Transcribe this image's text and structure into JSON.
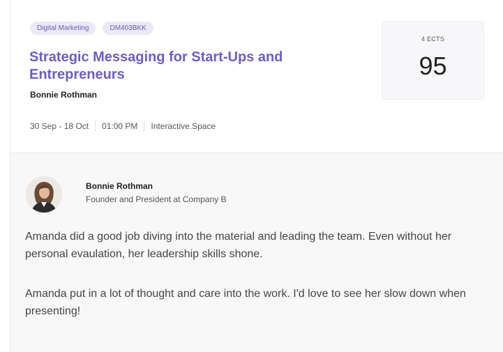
{
  "course": {
    "tags": [
      "Digital Marketing",
      "DM403BKK"
    ],
    "title": "Strategic Messaging for Start-Ups and Entrepreneurs",
    "author": "Bonnie Rothman",
    "meta": {
      "dates": "30 Sep - 18 Oct",
      "time": "01:00 PM",
      "location": "Interactive.Space"
    }
  },
  "score": {
    "label": "4 ECTS",
    "value": "95"
  },
  "review": {
    "reviewer_name": "Bonnie Rothman",
    "reviewer_role": "Founder and President at Company B",
    "paragraphs": [
      "Amanda did a good job diving into the material and leading the team. Even without her personal evaulation, her leadership skills shone.",
      "Amanda put in a lot of thought and care into the work. I'd love to see her slow down when presenting!"
    ]
  },
  "colors": {
    "accent": "#6f5cc6",
    "tag_bg": "#ece9f7",
    "tag_text": "#6b5bb5",
    "review_bg": "#f8f8f8"
  }
}
